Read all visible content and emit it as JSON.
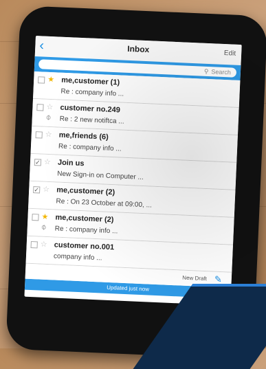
{
  "header": {
    "title": "Inbox",
    "back_icon": "chevron-left-icon",
    "edit_label": "Edit"
  },
  "search": {
    "placeholder": "Search",
    "icon": "search-icon"
  },
  "colors": {
    "accent": "#2f9ae6",
    "star_on": "#f2b705"
  },
  "messages": [
    {
      "checked": false,
      "starred": true,
      "attachment": false,
      "sender": "me,customer (1)",
      "subject": "Re : company info ..."
    },
    {
      "checked": false,
      "starred": false,
      "attachment": true,
      "sender": "customer no.249",
      "subject": "Re : 2 new notiftca ..."
    },
    {
      "checked": false,
      "starred": false,
      "attachment": false,
      "sender": "me,friends (6)",
      "subject": "Re : company info ..."
    },
    {
      "checked": true,
      "starred": false,
      "attachment": false,
      "sender": "Join us",
      "subject": "New Sign-in on Computer ..."
    },
    {
      "checked": true,
      "starred": false,
      "attachment": false,
      "sender": "me,customer  (2)",
      "subject": "Re : On 23 October at 09:00, ..."
    },
    {
      "checked": false,
      "starred": true,
      "attachment": true,
      "sender": "me,customer  (2)",
      "subject": "Re : company info ..."
    },
    {
      "checked": false,
      "starred": false,
      "attachment": false,
      "sender": "customer no.001",
      "subject": "company info ..."
    }
  ],
  "footer": {
    "draft_label": "New Draft",
    "compose_icon": "compose-icon",
    "status_text": "Updated just now"
  }
}
